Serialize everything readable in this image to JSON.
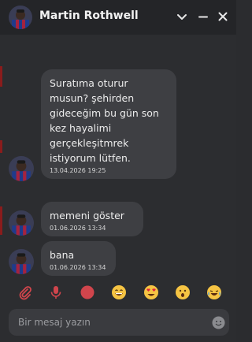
{
  "header": {
    "contact_name": "Martin Rothwell",
    "icons": [
      "chevron-down-icon",
      "minimize-icon",
      "close-icon"
    ]
  },
  "messages": [
    {
      "text": "Suratıma oturur musun? şehirden gideceğim bu gün son kez hayalimi gerçekleşitmrek istiyorum lütfen.",
      "time": "13.04.2026 19:25"
    },
    {
      "text": "memeni göster",
      "time": "01.06.2026 13:34"
    },
    {
      "text": "bana",
      "time": "01.06.2026 13:34"
    }
  ],
  "toolbar": {
    "items": [
      "paperclip-icon",
      "microphone-icon",
      "record-dot-icon",
      "grinning-emoji",
      "heart-eyes-emoji",
      "surprised-emoji",
      "crying-laughing-emoji"
    ]
  },
  "composer": {
    "placeholder": "Bir mesaj yazın",
    "value": ""
  },
  "colors": {
    "accent_red": "#d0454c",
    "bubble": "#3e3f43",
    "header": "#242528",
    "background": "#2c2d30"
  }
}
